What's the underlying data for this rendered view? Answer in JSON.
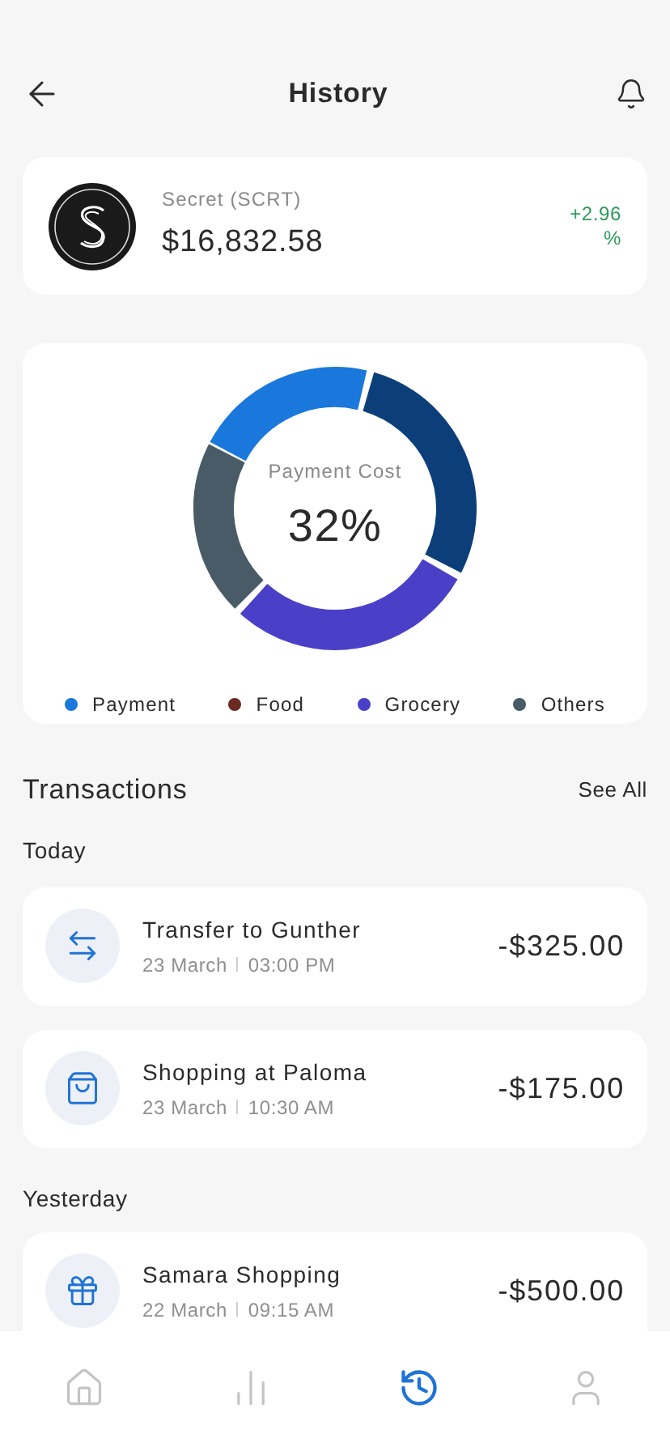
{
  "header": {
    "title": "History"
  },
  "asset": {
    "name": "Secret (SCRT)",
    "value": "$16,832.58",
    "change": "+2.96 %"
  },
  "cost_chart": {
    "label": "Payment Cost",
    "percent": "32%",
    "legend": [
      {
        "label": "Payment",
        "color": "#1a78dc"
      },
      {
        "label": "Food",
        "color": "#6b2b22"
      },
      {
        "label": "Grocery",
        "color": "#4a40c8"
      },
      {
        "label": "Others",
        "color": "#485b66"
      }
    ]
  },
  "transactions": {
    "title": "Transactions",
    "see_all": "See All",
    "groups": [
      {
        "label": "Today",
        "items": [
          {
            "kind": "transfer",
            "title": "Transfer to Gunther",
            "date": "23 March",
            "time": "03:00 PM",
            "amount": "-$325.00"
          },
          {
            "kind": "shopping",
            "title": "Shopping at Paloma",
            "date": "23 March",
            "time": "10:30 AM",
            "amount": "-$175.00"
          }
        ]
      },
      {
        "label": "Yesterday",
        "items": [
          {
            "kind": "gift",
            "title": "Samara Shopping",
            "date": "22 March",
            "time": "09:15 AM",
            "amount": "-$500.00"
          }
        ]
      }
    ]
  },
  "nav": [
    {
      "kind": "home",
      "selected": false
    },
    {
      "kind": "stats",
      "selected": false
    },
    {
      "kind": "history",
      "selected": true
    },
    {
      "kind": "profile",
      "selected": false
    }
  ]
}
